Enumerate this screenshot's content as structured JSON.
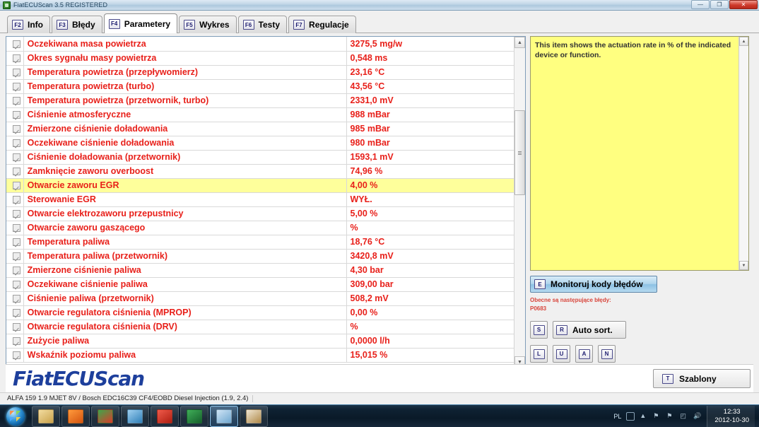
{
  "window": {
    "title": "FiatECUScan 3.5 REGISTERED",
    "minimize_label": "—",
    "maximize_label": "❐",
    "close_label": "✕"
  },
  "tabs": [
    {
      "key": "F2",
      "label": "Info",
      "active": false
    },
    {
      "key": "F3",
      "label": "Błędy",
      "active": false
    },
    {
      "key": "F4",
      "label": "Parametery",
      "active": true
    },
    {
      "key": "F5",
      "label": "Wykres",
      "active": false
    },
    {
      "key": "F6",
      "label": "Testy",
      "active": false
    },
    {
      "key": "F7",
      "label": "Regulacje",
      "active": false
    }
  ],
  "grid": {
    "rows": [
      {
        "checked": true,
        "name": "Oczekiwana masa powietrza",
        "value": "3275,5 mg/w",
        "selected": false
      },
      {
        "checked": true,
        "name": "Okres sygnału masy powietrza",
        "value": "0,548 ms",
        "selected": false
      },
      {
        "checked": true,
        "name": "Temperatura powietrza (przepływomierz)",
        "value": "23,16 °C",
        "selected": false
      },
      {
        "checked": true,
        "name": "Temperatura powietrza (turbo)",
        "value": "43,56 °C",
        "selected": false
      },
      {
        "checked": true,
        "name": "Temperatura powietrza (przetwornik, turbo)",
        "value": "2331,0 mV",
        "selected": false
      },
      {
        "checked": true,
        "name": "Ciśnienie atmosferyczne",
        "value": "988 mBar",
        "selected": false
      },
      {
        "checked": true,
        "name": "Zmierzone ciśnienie doładowania",
        "value": "985 mBar",
        "selected": false
      },
      {
        "checked": true,
        "name": "Oczekiwane ciśnienie doładowania",
        "value": "980 mBar",
        "selected": false
      },
      {
        "checked": true,
        "name": "Ciśnienie doładowania (przetwornik)",
        "value": "1593,1 mV",
        "selected": false
      },
      {
        "checked": true,
        "name": "Zamknięcie zaworu overboost",
        "value": "74,96 %",
        "selected": false
      },
      {
        "checked": true,
        "name": "Otwarcie zaworu EGR",
        "value": "4,00 %",
        "selected": true
      },
      {
        "checked": true,
        "name": "Sterowanie EGR",
        "value": "WYŁ.",
        "selected": false
      },
      {
        "checked": true,
        "name": "Otwarcie elektrozaworu przepustnicy",
        "value": "5,00 %",
        "selected": false
      },
      {
        "checked": true,
        "name": "Otwarcie zaworu gaszącego",
        "value": " %",
        "selected": false
      },
      {
        "checked": true,
        "name": "Temperatura paliwa",
        "value": "18,76 °C",
        "selected": false
      },
      {
        "checked": true,
        "name": "Temperatura paliwa (przetwornik)",
        "value": "3420,8 mV",
        "selected": false
      },
      {
        "checked": true,
        "name": "Zmierzone ciśnienie paliwa",
        "value": "4,30 bar",
        "selected": false
      },
      {
        "checked": true,
        "name": "Oczekiwane ciśnienie paliwa",
        "value": "309,00 bar",
        "selected": false
      },
      {
        "checked": true,
        "name": "Ciśnienie paliwa (przetwornik)",
        "value": "508,2 mV",
        "selected": false
      },
      {
        "checked": true,
        "name": "Otwarcie regulatora ciśnienia (MPROP)",
        "value": "0,00 %",
        "selected": false
      },
      {
        "checked": true,
        "name": "Otwarcie regulatora ciśnienia (DRV)",
        "value": " %",
        "selected": false
      },
      {
        "checked": true,
        "name": "Zużycie paliwa",
        "value": "0,0000 l/h",
        "selected": false
      },
      {
        "checked": true,
        "name": "Wskaźnik poziomu paliwa",
        "value": "15,015 %",
        "selected": false
      }
    ]
  },
  "help": {
    "text": "This item shows the actuation rate in % of the indicated device or function."
  },
  "side": {
    "monitor_key": "E",
    "monitor_label": "Monitoruj kody błędów",
    "errors_header": "Obecne są następujące błędy:",
    "error_codes": "P0683",
    "s_key": "S",
    "autosort_key": "R",
    "autosort_label": "Auto sort.",
    "l_key": "L",
    "u_key": "U",
    "a_key": "A",
    "n_key": "N"
  },
  "footer": {
    "brand": "FiatECUScan",
    "templates_key": "T",
    "templates_label": "Szablony",
    "status": "ALFA 159 1.9 MJET 8V / Bosch EDC16C39 CF4/EOBD Diesel Injection (1.9, 2.4)"
  },
  "taskbar": {
    "start_icon": "windows-orb",
    "items": [
      {
        "icon": "explorer-icon",
        "color1": "#f2dca0",
        "color2": "#c9a24b"
      },
      {
        "icon": "media-player-icon",
        "color1": "#ff9a3c",
        "color2": "#d4540f"
      },
      {
        "icon": "chrome-icon",
        "color1": "#3ea64a",
        "color2": "#d93b2b"
      },
      {
        "icon": "control-panel-icon",
        "color1": "#9fd0f0",
        "color2": "#2f7fb8"
      },
      {
        "icon": "toolbox-icon",
        "color1": "#ef5a4a",
        "color2": "#b01f12"
      },
      {
        "icon": "scanner-icon",
        "color1": "#3fae58",
        "color2": "#16612c"
      },
      {
        "icon": "book-icon",
        "color1": "#cfe4f5",
        "color2": "#6fa7cf"
      },
      {
        "icon": "paint-icon",
        "color1": "#f0e6d2",
        "color2": "#b08a4a"
      }
    ],
    "tray_lang": "PL",
    "time": "12:33",
    "date": "2012-10-30"
  }
}
